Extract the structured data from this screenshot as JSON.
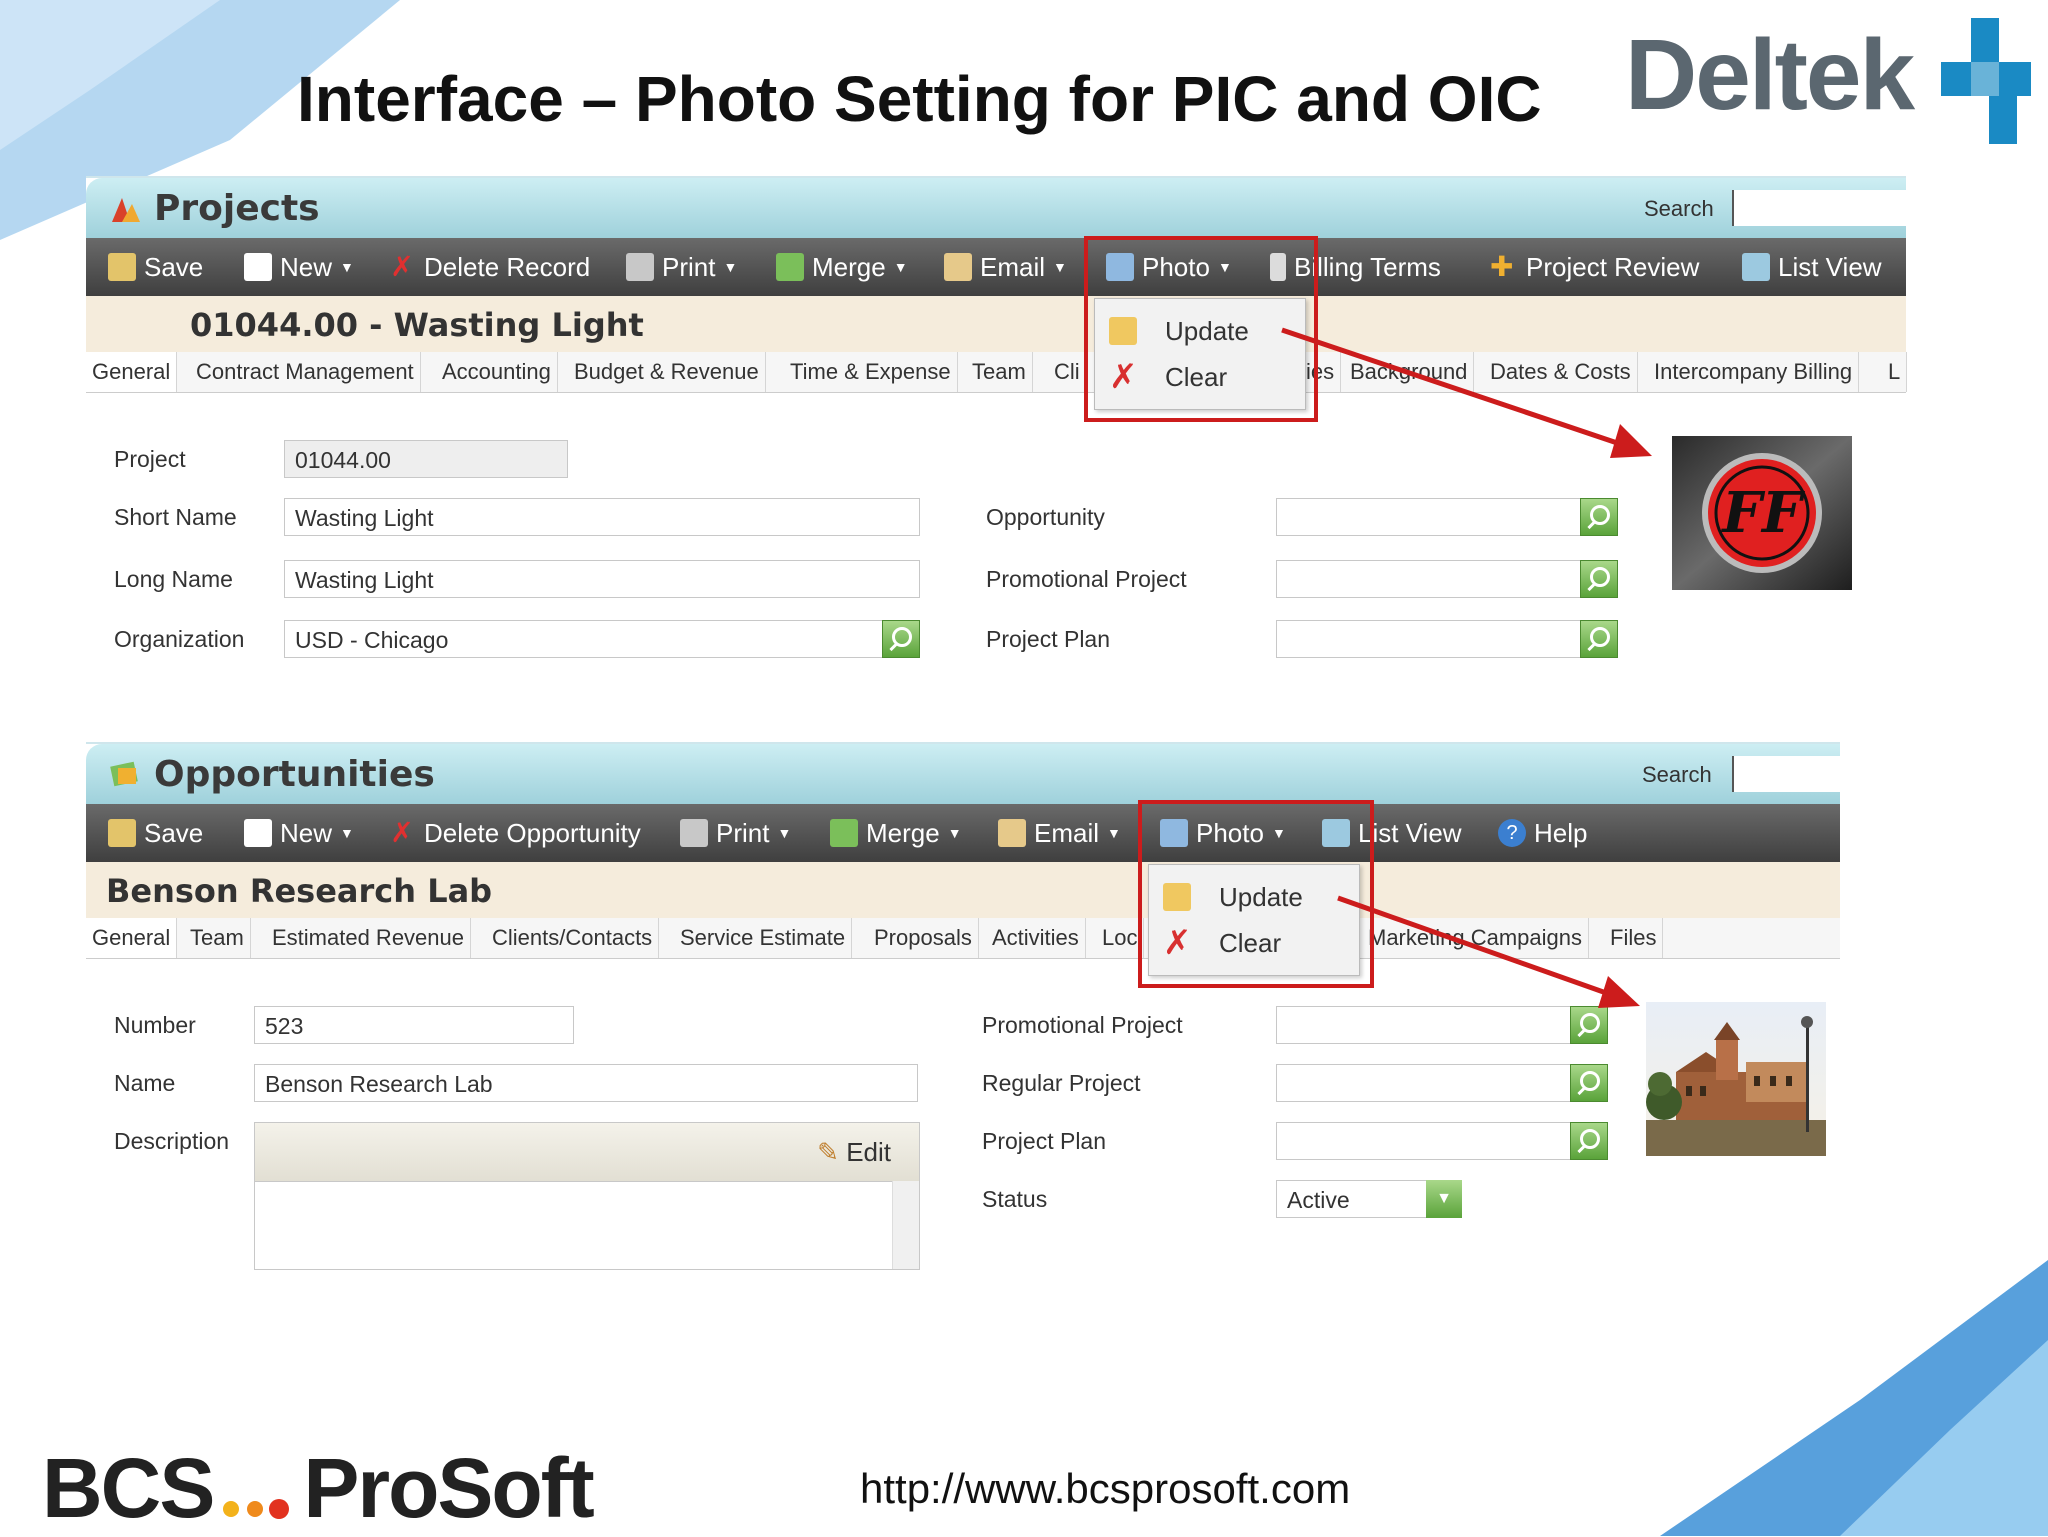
{
  "slide": {
    "title": "Interface – Photo Setting for PIC and OIC",
    "url": "http://www.bcsprosoft.com",
    "logo_right_text": "Deltek",
    "logo_left_text_a": "BCS",
    "logo_left_text_b": "ProSoft"
  },
  "colors": {
    "accent_red": "#cc1c1c",
    "toolbar_bg": "#4a4a4a",
    "header_teal": "#b6e0e8",
    "lookup_green": "#6ab04c"
  },
  "projects": {
    "title": "Projects",
    "search_label": "Search",
    "toolbar": {
      "save": "Save",
      "new": "New",
      "delete": "Delete Record",
      "print": "Print",
      "merge": "Merge",
      "email": "Email",
      "photo": "Photo",
      "billing": "Billing Terms",
      "review": "Project Review",
      "list": "List View"
    },
    "photo_menu": {
      "update": "Update",
      "clear": "Clear"
    },
    "record_title": "01044.00 - Wasting Light",
    "tabs": [
      "General",
      "Contract Management",
      "Accounting",
      "Budget & Revenue",
      "Time & Expense",
      "Team",
      "Cli",
      "ies",
      "Background",
      "Dates & Costs",
      "Intercompany Billing",
      "L"
    ],
    "fields": {
      "project_label": "Project",
      "project_value": "01044.00",
      "short_label": "Short Name",
      "short_value": "Wasting Light",
      "long_label": "Long Name",
      "long_value": "Wasting Light",
      "org_label": "Organization",
      "org_value": "USD - Chicago",
      "opp_label": "Opportunity",
      "promo_label": "Promotional Project",
      "plan_label": "Project Plan"
    },
    "photo_logo_text": "FF"
  },
  "opportunities": {
    "title": "Opportunities",
    "search_label": "Search",
    "toolbar": {
      "save": "Save",
      "new": "New",
      "delete": "Delete Opportunity",
      "print": "Print",
      "merge": "Merge",
      "email": "Email",
      "photo": "Photo",
      "list": "List View",
      "help": "Help"
    },
    "photo_menu": {
      "update": "Update",
      "clear": "Clear"
    },
    "record_title": "Benson Research Lab",
    "tabs": [
      "General",
      "Team",
      "Estimated Revenue",
      "Clients/Contacts",
      "Service Estimate",
      "Proposals",
      "Activities",
      "Loc",
      "Marketing Campaigns",
      "Files"
    ],
    "fields": {
      "number_label": "Number",
      "number_value": "523",
      "name_label": "Name",
      "name_value": "Benson Research Lab",
      "desc_label": "Description",
      "edit_label": "Edit",
      "promo_label": "Promotional Project",
      "regular_label": "Regular Project",
      "plan_label": "Project Plan",
      "status_label": "Status",
      "status_value": "Active"
    }
  }
}
